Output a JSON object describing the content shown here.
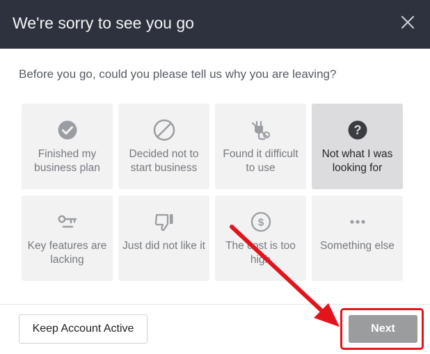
{
  "dialog": {
    "title": "We're sorry to see you go",
    "question": "Before you go, could you please tell us why you are leaving?"
  },
  "reasons": [
    {
      "label": "Finished my business plan",
      "icon": "check-circle-icon",
      "selected": false
    },
    {
      "label": "Decided not to start business",
      "icon": "no-entry-icon",
      "selected": false
    },
    {
      "label": "Found it difficult to use",
      "icon": "unplugged-icon",
      "selected": false
    },
    {
      "label": "Not what I was looking for",
      "icon": "question-circle-icon",
      "selected": true
    },
    {
      "label": "Key features are lacking",
      "icon": "key-icon",
      "selected": false
    },
    {
      "label": "Just did not like it",
      "icon": "thumbs-down-icon",
      "selected": false
    },
    {
      "label": "The cost is too high",
      "icon": "dollar-circle-icon",
      "selected": false
    },
    {
      "label": "Something else",
      "icon": "ellipsis-icon",
      "selected": false
    }
  ],
  "footer": {
    "keep_label": "Keep Account Active",
    "next_label": "Next"
  },
  "colors": {
    "header_bg": "#2e323f",
    "card_bg": "#f2f2f3",
    "card_selected_bg": "#dcdcde",
    "icon_gray": "#9a9da1",
    "icon_dark": "#3a3c41",
    "next_bg": "#9b9c9e",
    "annotation_red": "#e3141b"
  }
}
